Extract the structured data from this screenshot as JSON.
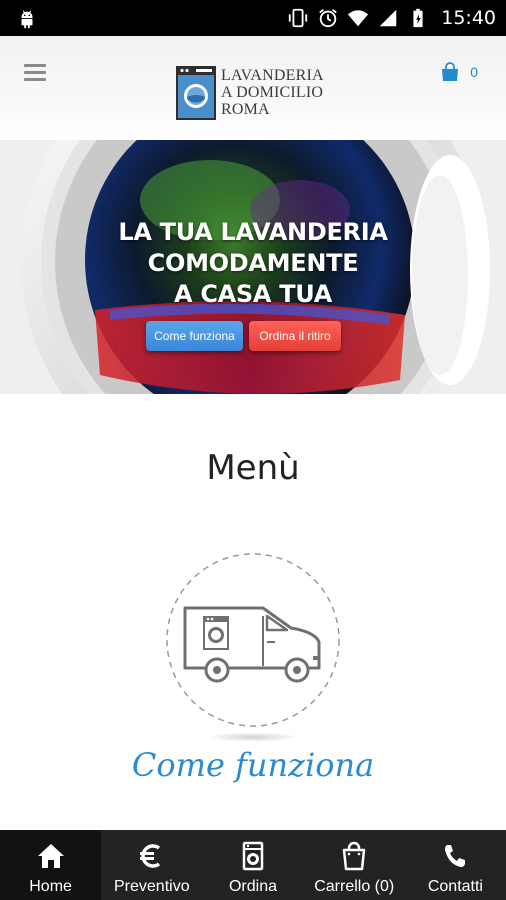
{
  "status_bar": {
    "time": "15:40",
    "icons": [
      "android-icon",
      "vibrate-icon",
      "alarm-icon",
      "wifi-icon",
      "signal-icon",
      "battery-icon"
    ]
  },
  "header": {
    "menu_icon": "hamburger-icon",
    "logo_lines": [
      "LAVANDERIA",
      "A DOMICILIO",
      "ROMA"
    ],
    "cart_icon": "shopping-bag-icon",
    "cart_count": "0"
  },
  "hero": {
    "title_lines": [
      "LA TUA LAVANDERIA",
      "COMODAMENTE",
      "A CASA TUA"
    ],
    "button_how": "Come funziona",
    "button_order": "Ordina il ritiro"
  },
  "menu": {
    "title": "Menù",
    "feature_icon": "delivery-van-icon",
    "feature_label": "Come funziona"
  },
  "bottom_nav": {
    "items": [
      {
        "label": "Home",
        "icon": "home-icon"
      },
      {
        "label": "Preventivo",
        "icon": "euro-icon"
      },
      {
        "label": "Ordina",
        "icon": "washing-machine-icon"
      },
      {
        "label": "Carrello (0)",
        "icon": "shopping-bag-icon"
      },
      {
        "label": "Contatti",
        "icon": "phone-icon"
      }
    ]
  },
  "colors": {
    "accent_blue": "#2a8ad3",
    "button_blue": "#3b86d6",
    "button_red": "#e23f37",
    "nav_background": "#232323",
    "status_bar": "#000000"
  }
}
